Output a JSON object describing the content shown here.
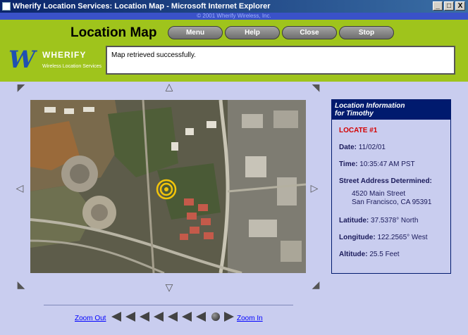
{
  "window": {
    "title": "Wherify Location Services: Location Map - Microsoft Internet Explorer",
    "copyright": "© 2001 Wherify Wireless, Inc.",
    "minimize": "_",
    "maximize": "□",
    "close": "X"
  },
  "header": {
    "page_title": "Location Map",
    "buttons": [
      "Menu",
      "Help",
      "Close",
      "Stop"
    ],
    "logo_letter": "W",
    "logo_name": "WHERIFY",
    "logo_tagline": "Wireless Location Services",
    "status_message": "Map retrieved successfully."
  },
  "info": {
    "heading_line1": "Location Information",
    "heading_line2": "for Timothy",
    "locate": "LOCATE #1",
    "date_label": "Date:",
    "date_value": "11/02/01",
    "time_label": "Time:",
    "time_value": "10:35:47 AM PST",
    "address_label": "Street Address Determined:",
    "address_line1": "4520 Main Street",
    "address_line2": "San Francisco, CA 95391",
    "latitude_label": "Latitude:",
    "latitude_value": "37.5378° North",
    "longitude_label": "Longitude:",
    "longitude_value": "122.2565° West",
    "altitude_label": "Altitude:",
    "altitude_value": "25.5 Feet"
  },
  "zoom": {
    "out_label": "Zoom Out",
    "in_label": "Zoom In"
  },
  "colors": {
    "header_green": "#9fc41c",
    "page_blue": "#c9cdef",
    "panel_navy": "#001a6e",
    "locate_red": "#d40000",
    "marker_yellow": "#f2c40a"
  },
  "icons": {
    "pan_arrows": [
      "pan-up-left-icon",
      "pan-up-icon",
      "pan-up-right-icon",
      "pan-left-icon",
      "pan-right-icon",
      "pan-down-left-icon",
      "pan-down-icon",
      "pan-down-right-icon"
    ],
    "location_marker": "target-marker-icon"
  }
}
